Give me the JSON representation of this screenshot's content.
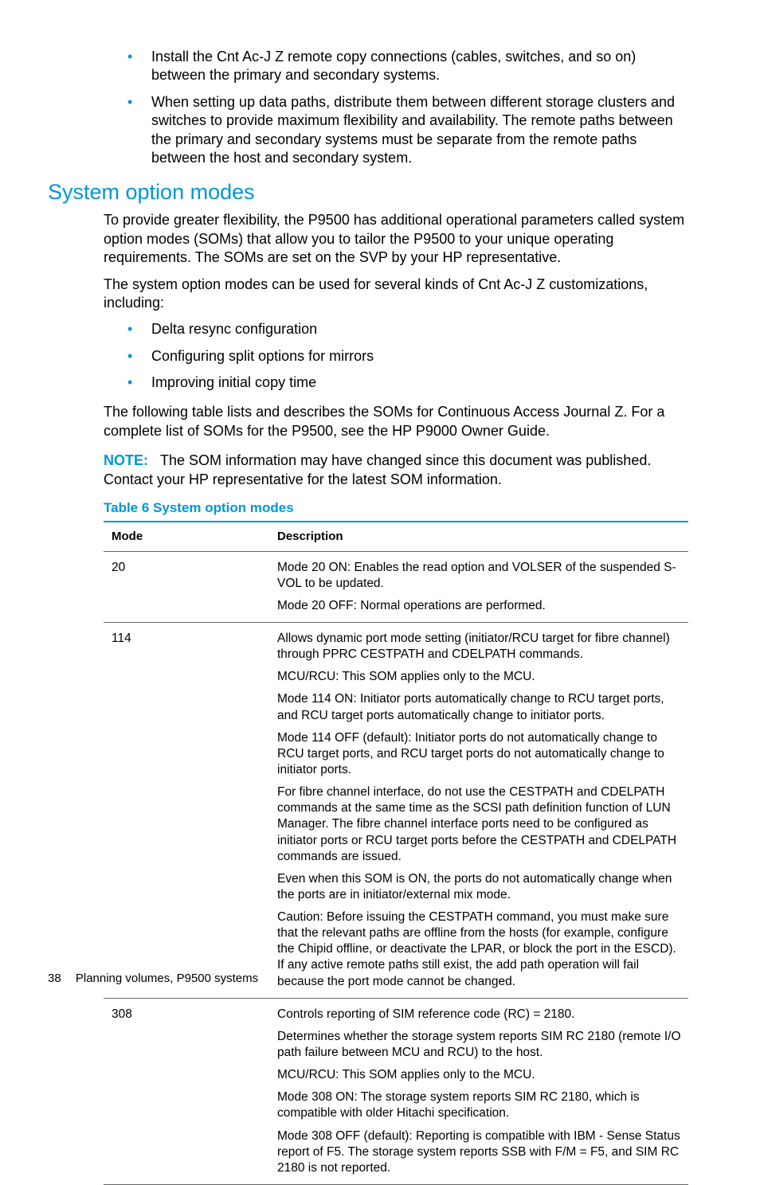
{
  "intro_bullets": [
    "Install the Cnt Ac-J Z remote copy connections (cables, switches, and so on) between the primary and secondary systems.",
    "When setting up data paths, distribute them between different storage clusters and switches to provide maximum flexibility and availability. The remote paths between the primary and secondary systems must be separate from the remote paths between the host and secondary system."
  ],
  "section_heading": "System option modes",
  "section_para1": "To provide greater flexibility, the P9500 has additional operational parameters called system option modes (SOMs) that allow you to tailor the P9500 to your unique operating requirements. The SOMs are set on the SVP by your HP representative.",
  "section_para2": "The system option modes can be used for several kinds of Cnt Ac-J Z customizations, including:",
  "config_bullets": [
    "Delta resync configuration",
    "Configuring split options for mirrors",
    "Improving initial copy time"
  ],
  "section_para3": "The following table lists and describes the SOMs for Continuous Access Journal Z. For a complete list of SOMs for the P9500, see the HP P9000 Owner Guide.",
  "note_label": "NOTE:",
  "note_text": "The SOM information may have changed since this document was published. Contact your HP representative for the latest SOM information.",
  "table_caption": "Table 6 System option modes",
  "table_headers": {
    "mode": "Mode",
    "description": "Description"
  },
  "table_rows": [
    {
      "mode": "20",
      "desc": [
        "Mode 20 ON: Enables the read option and VOLSER of the suspended S-VOL to be updated.",
        "Mode 20 OFF: Normal operations are performed."
      ]
    },
    {
      "mode": "114",
      "desc": [
        "Allows dynamic port mode setting (initiator/RCU target for fibre channel) through PPRC CESTPATH and CDELPATH commands.",
        "MCU/RCU: This SOM applies only to the MCU.",
        "Mode 114 ON: Initiator ports automatically change to RCU target ports, and RCU target ports automatically change to initiator ports.",
        "Mode 114 OFF (default): Initiator ports do not automatically change to RCU target ports, and RCU target ports do not automatically change to initiator ports.",
        "For fibre channel interface, do not use the CESTPATH and CDELPATH commands at the same time as the SCSI path definition function of LUN Manager. The fibre channel interface ports need to be configured as initiator ports or RCU target ports before the CESTPATH and CDELPATH commands are issued.",
        "Even when this SOM is ON, the ports do not automatically change when the ports are in initiator/external mix mode.",
        "__CAUTION__Before issuing the CESTPATH command, you must make sure that the relevant paths are offline from the hosts (for example, configure the Chipid offline, or deactivate the LPAR, or block the port in the ESCD). If any active remote paths still exist, the add path operation will fail because the port mode cannot be changed."
      ]
    },
    {
      "mode": "308",
      "desc": [
        "Controls reporting of SIM reference code (RC) = 2180.",
        "Determines whether the storage system reports SIM RC 2180 (remote I/O path failure between MCU and RCU) to the host.",
        "MCU/RCU: This SOM applies only to the MCU.",
        "Mode 308 ON: The storage system reports SIM RC 2180, which is compatible with older Hitachi specification.",
        "Mode 308 OFF (default): Reporting is compatible with IBM - Sense Status report of F5. The storage system reports SSB with F/M = F5, and SIM RC 2180 is not reported."
      ]
    }
  ],
  "caution_label": "Caution:",
  "footer": {
    "page_number": "38",
    "chapter": "Planning volumes, P9500 systems"
  }
}
